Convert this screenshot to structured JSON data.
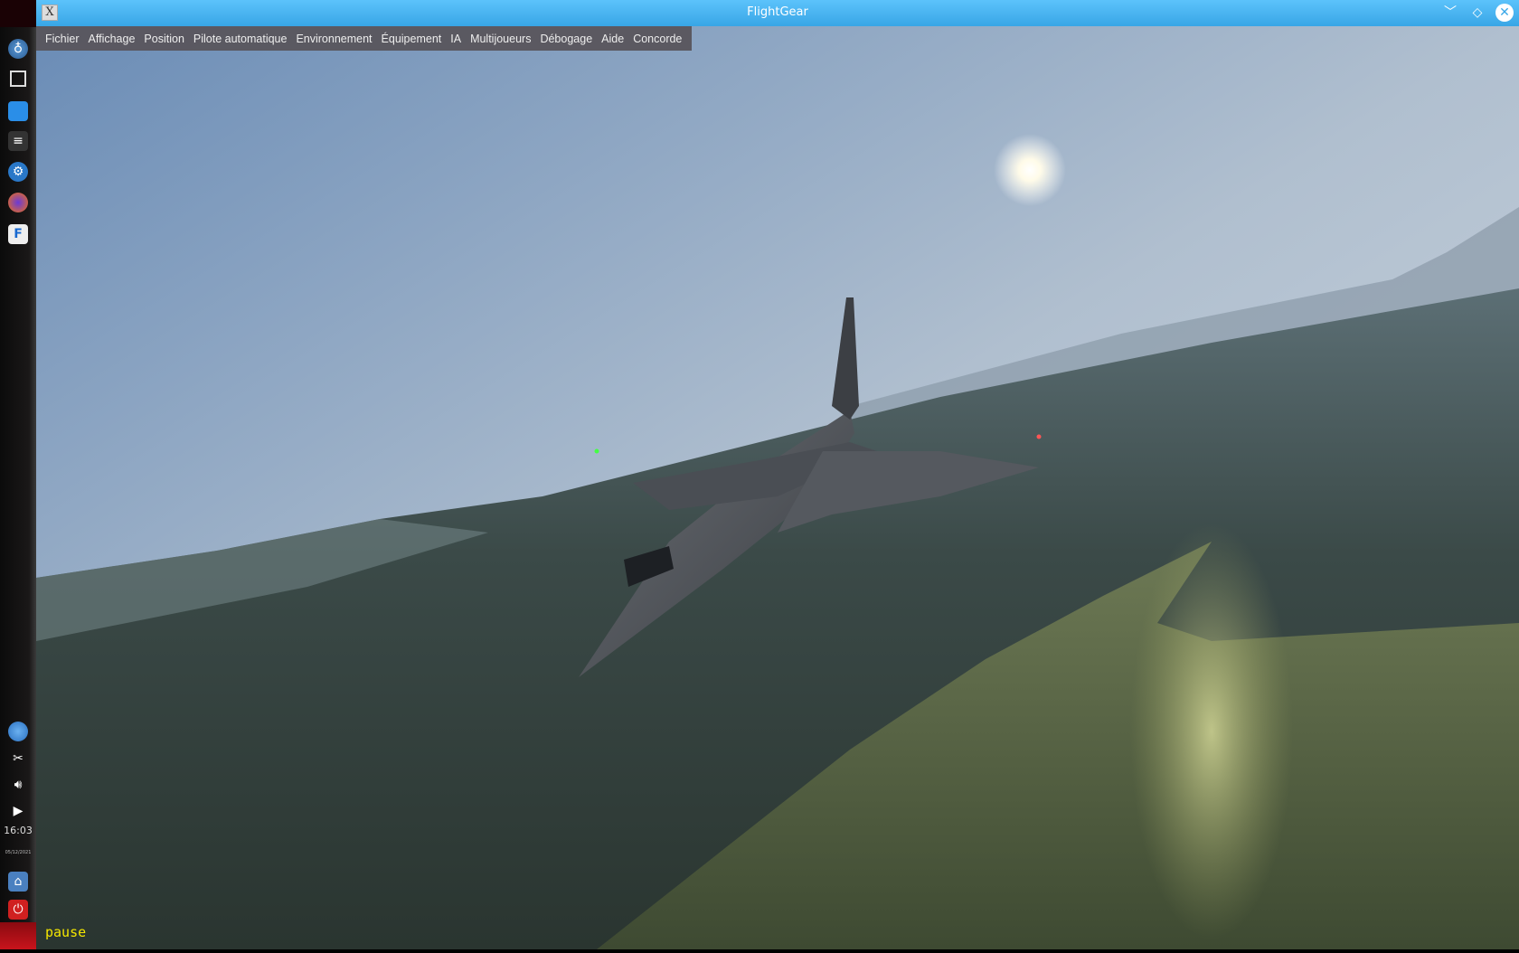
{
  "window": {
    "title": "FlightGear",
    "app_icon": "X"
  },
  "window_buttons": {
    "minimize": "﹀",
    "maximize": "◇",
    "close": "✕"
  },
  "menu": [
    "Fichier",
    "Affichage",
    "Position",
    "Pilote automatique",
    "Environnement",
    "Équipement",
    "IA",
    "Multijoueurs",
    "Débogage",
    "Aide",
    "Concorde"
  ],
  "dock": {
    "launcher_icons": [
      "app-menu-icon",
      "terminal-icon",
      "folder-icon",
      "settings-icon",
      "gear-icon",
      "firefox-icon",
      "flightgear-icon"
    ],
    "tray_icons": [
      "network-icon",
      "scissors-icon",
      "volume-icon",
      "expand-arrow-icon"
    ],
    "clock": "16:03",
    "date": "05/12/2021",
    "bottom_icons": [
      "lock-icon",
      "power-icon"
    ]
  },
  "status": {
    "pause_label": "pause"
  },
  "colors": {
    "titlebar": "#3daee9",
    "pause_text": "#f4e600"
  }
}
